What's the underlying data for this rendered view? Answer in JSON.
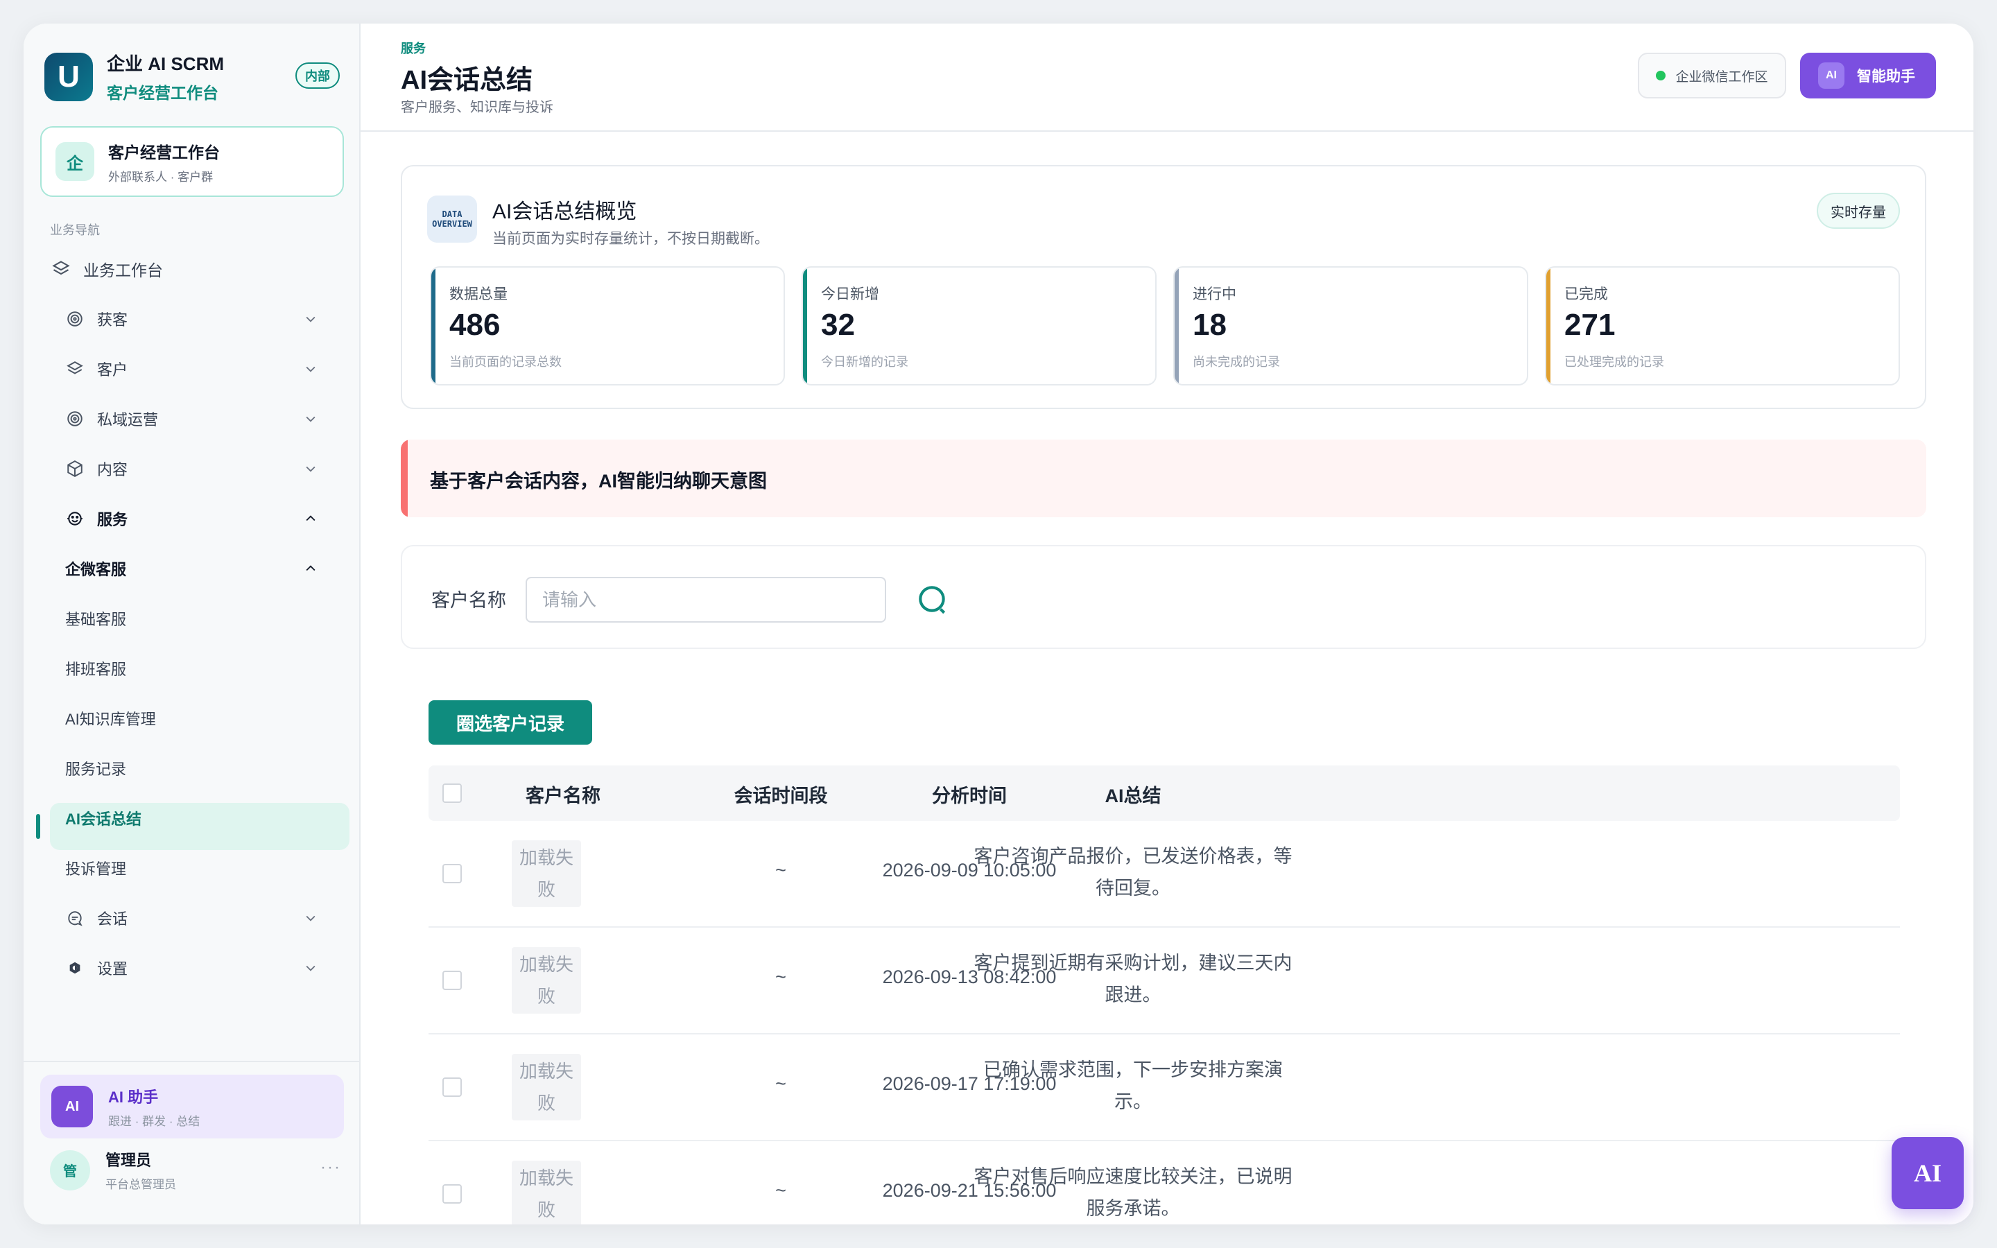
{
  "brand": {
    "title": "企业 AI SCRM",
    "subtitle": "客户经营工作台",
    "badge": "内部",
    "logo_letter": "U"
  },
  "workspace": {
    "icon": "企",
    "title": "客户经营工作台",
    "subtitle": "外部联系人 · 客户群"
  },
  "nav_header": "业务导航",
  "nav": {
    "workbench": "业务工作台",
    "acquire": "获客",
    "customer": "客户",
    "private_ops": "私域运营",
    "content": "内容",
    "service": "服务",
    "wecom_service": "企微客服",
    "basic_service": "基础客服",
    "shift_service": "排班客服",
    "ai_kb": "AI知识库管理",
    "service_records": "服务记录",
    "ai_summary": "AI会话总结",
    "complaints": "投诉管理",
    "session": "会话",
    "settings": "设置"
  },
  "ai_card": {
    "icon": "AI",
    "title": "AI 助手",
    "subtitle": "跟进 · 群发 · 总结"
  },
  "user": {
    "avatar": "管",
    "name": "管理员",
    "role": "平台总管理员",
    "more": "···"
  },
  "header": {
    "breadcrumb": "服务",
    "title": "AI会话总结",
    "subtitle": "客户服务、知识库与投诉",
    "env_label": "企业微信工作区",
    "ai_btn_chip": "AI",
    "ai_btn_label": "智能助手"
  },
  "overview": {
    "icon_line1": "DATA",
    "icon_line2": "OVERVIEW",
    "title": "AI会话总结概览",
    "subtitle": "当前页面为实时存量统计，不按日期截断。",
    "badge": "实时存量",
    "stats": [
      {
        "label": "数据总量",
        "value": "486",
        "note": "当前页面的记录总数",
        "color": "#1e6a8a"
      },
      {
        "label": "今日新增",
        "value": "32",
        "note": "今日新增的记录",
        "color": "#0f8c7e"
      },
      {
        "label": "进行中",
        "value": "18",
        "note": "尚未完成的记录",
        "color": "#94a3b8"
      },
      {
        "label": "已完成",
        "value": "271",
        "note": "已处理完成的记录",
        "color": "#e0a030"
      }
    ]
  },
  "banner": "基于客户会话内容，AI智能归纳聊天意图",
  "filter": {
    "label": "客户名称",
    "placeholder": "请输入"
  },
  "select_button": "圈选客户记录",
  "table": {
    "columns": [
      "客户名称",
      "会话时间段",
      "分析时间",
      "AI总结"
    ],
    "rows": [
      {
        "image": "加载失败",
        "period": "~",
        "time": "2026-09-09 10:05:00",
        "summary": "客户咨询产品报价，已发送价格表，等待回复。"
      },
      {
        "image": "加载失败",
        "period": "~",
        "time": "2026-09-13 08:42:00",
        "summary": "客户提到近期有采购计划，建议三天内跟进。"
      },
      {
        "image": "加载失败",
        "period": "~",
        "time": "2026-09-17 17:19:00",
        "summary": "已确认需求范围，下一步安排方案演示。"
      },
      {
        "image": "加载失败",
        "period": "~",
        "time": "2026-09-21 15:56:00",
        "summary": "客户对售后响应速度比较关注，已说明服务承诺。"
      }
    ]
  },
  "fab": "AI",
  "colors": {
    "accent": "#0f8c7e",
    "ai_purple": "#7b4fe0",
    "banner_bar": "#f87171"
  }
}
